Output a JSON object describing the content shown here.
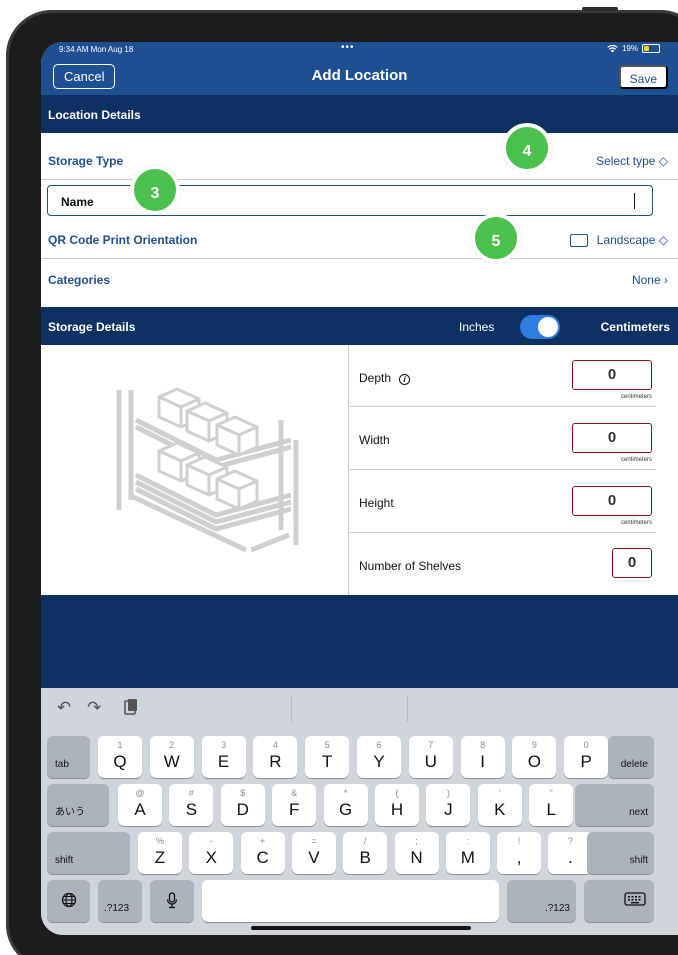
{
  "status": {
    "time": "9:34 AM  Mon Aug 18",
    "dots": "•••",
    "wifi": "wifi-icon",
    "battery": "19%"
  },
  "nav": {
    "cancel": "Cancel",
    "title": "Add Location",
    "save": "Save"
  },
  "location_details": {
    "header": "Location Details",
    "storage_type": {
      "label": "Storage Type",
      "value": "Select type ◇"
    },
    "name": {
      "placeholder": "Name"
    },
    "qr": {
      "label": "QR Code Print Orientation",
      "value": "Landscape ◇"
    },
    "categories": {
      "label": "Categories",
      "value": "None ›"
    }
  },
  "badges": {
    "b3": "3",
    "b4": "4",
    "b5": "5"
  },
  "storage_details": {
    "header": "Storage Details",
    "toggle_left": "Inches",
    "toggle_right": "Centimeters",
    "toggle_on": true,
    "fields": [
      {
        "label": "Depth",
        "value": "0",
        "unit": "centimeters"
      },
      {
        "label": "Width",
        "value": "0",
        "unit": "centimeters"
      },
      {
        "label": "Height",
        "value": "0",
        "unit": "centimeters"
      },
      {
        "label": "Number of Shelves",
        "value": "0"
      }
    ],
    "info": "i"
  },
  "keyboard": {
    "toolbar": {
      "undo": "undo-icon",
      "redo": "redo-icon",
      "paste": "paste-icon"
    },
    "row1": [
      {
        "k": "Q",
        "s": "1"
      },
      {
        "k": "W",
        "s": "2"
      },
      {
        "k": "E",
        "s": "3"
      },
      {
        "k": "R",
        "s": "4"
      },
      {
        "k": "T",
        "s": "5"
      },
      {
        "k": "Y",
        "s": "6"
      },
      {
        "k": "U",
        "s": "7"
      },
      {
        "k": "I",
        "s": "8"
      },
      {
        "k": "O",
        "s": "9"
      },
      {
        "k": "P",
        "s": "0"
      }
    ],
    "row2": [
      {
        "k": "A",
        "s": "@"
      },
      {
        "k": "S",
        "s": "#"
      },
      {
        "k": "D",
        "s": "$"
      },
      {
        "k": "F",
        "s": "&"
      },
      {
        "k": "G",
        "s": "*"
      },
      {
        "k": "H",
        "s": "("
      },
      {
        "k": "J",
        "s": ")"
      },
      {
        "k": "K",
        "s": "’"
      },
      {
        "k": "L",
        "s": "”"
      }
    ],
    "row3": [
      {
        "k": "Z",
        "s": "%"
      },
      {
        "k": "X",
        "s": "-"
      },
      {
        "k": "C",
        "s": "+"
      },
      {
        "k": "V",
        "s": "="
      },
      {
        "k": "B",
        "s": "/"
      },
      {
        "k": "N",
        "s": ";"
      },
      {
        "k": "M",
        "s": ":"
      },
      {
        "k": ",",
        "s": "!"
      },
      {
        "k": ".",
        "s": "?"
      }
    ],
    "tab": "tab",
    "delete": "delete",
    "aiu": "あいう",
    "next": "next",
    "shift": "shift",
    "num": ".?123",
    "globe": "globe-icon",
    "mic": "mic-icon",
    "hide": "keyboard-icon"
  }
}
